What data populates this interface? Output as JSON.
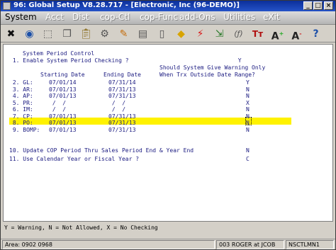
{
  "window": {
    "title": "96: Global Setup V8.28.717 - [Electronic, Inc (96-DEMO)]"
  },
  "menu": {
    "items": [
      "System",
      "Acct",
      "Dist",
      "cop-Ctl",
      "cop-Func",
      "add-Ons",
      "Utilities",
      "eXit"
    ]
  },
  "toolbar": {
    "icons": [
      "close-x-icon",
      "globe-icon",
      "selection-icon",
      "copy-icon",
      "paste-icon",
      "settings-icon",
      "edit-icon",
      "list-icon",
      "tag-icon",
      "lightning-icon",
      "export-icon",
      "function-icon",
      "font-tt-icon",
      "font-increase-icon",
      "font-decrease-icon",
      "help-icon"
    ]
  },
  "console": {
    "heading": "System Period Control",
    "line1": " 1. Enable System Period Checking ?                                Y",
    "warn_header1": "Should System Give Warning Only",
    "warn_header2": "When Trx Outside Date Range?",
    "col_start": "Starting Date",
    "col_end": "Ending Date",
    "rows": [
      {
        "label": " 2. GL:",
        "start": "07/01/14",
        "end": "07/31/14",
        "flag": "Y"
      },
      {
        "label": " 3. AR:",
        "start": "07/01/13",
        "end": "07/31/13",
        "flag": "N"
      },
      {
        "label": " 4. AP:",
        "start": "07/01/13",
        "end": "07/31/13",
        "flag": "N"
      },
      {
        "label": " 5. PR:",
        "start": " /  /",
        "end": " /  /",
        "flag": "X"
      },
      {
        "label": " 6. IM:",
        "start": " /  /",
        "end": " /  /",
        "flag": "N"
      },
      {
        "label": " 7. CP:",
        "start": "07/01/13",
        "end": "07/31/13",
        "flag": "N"
      },
      {
        "label": " 8. PO:",
        "start": "07/01/13",
        "end": "07/31/13",
        "flag": "N"
      },
      {
        "label": " 9. BOMP:",
        "start": "07/01/13",
        "end": "07/31/13",
        "flag": "N"
      }
    ],
    "line10": "10. Update COP Period Thru Sales Period End & Year End",
    "line10_flag": "N",
    "line11": "11. Use Calendar Year or Fiscal Year ?",
    "line11_flag": "C"
  },
  "footer": {
    "legend": "Y = Warning, N = Not Allowed, X = No Checking"
  },
  "status": {
    "area": "Area: 0902 0968",
    "user": "003 ROGER at JCOB",
    "terminal": "NSCTLMN1"
  }
}
